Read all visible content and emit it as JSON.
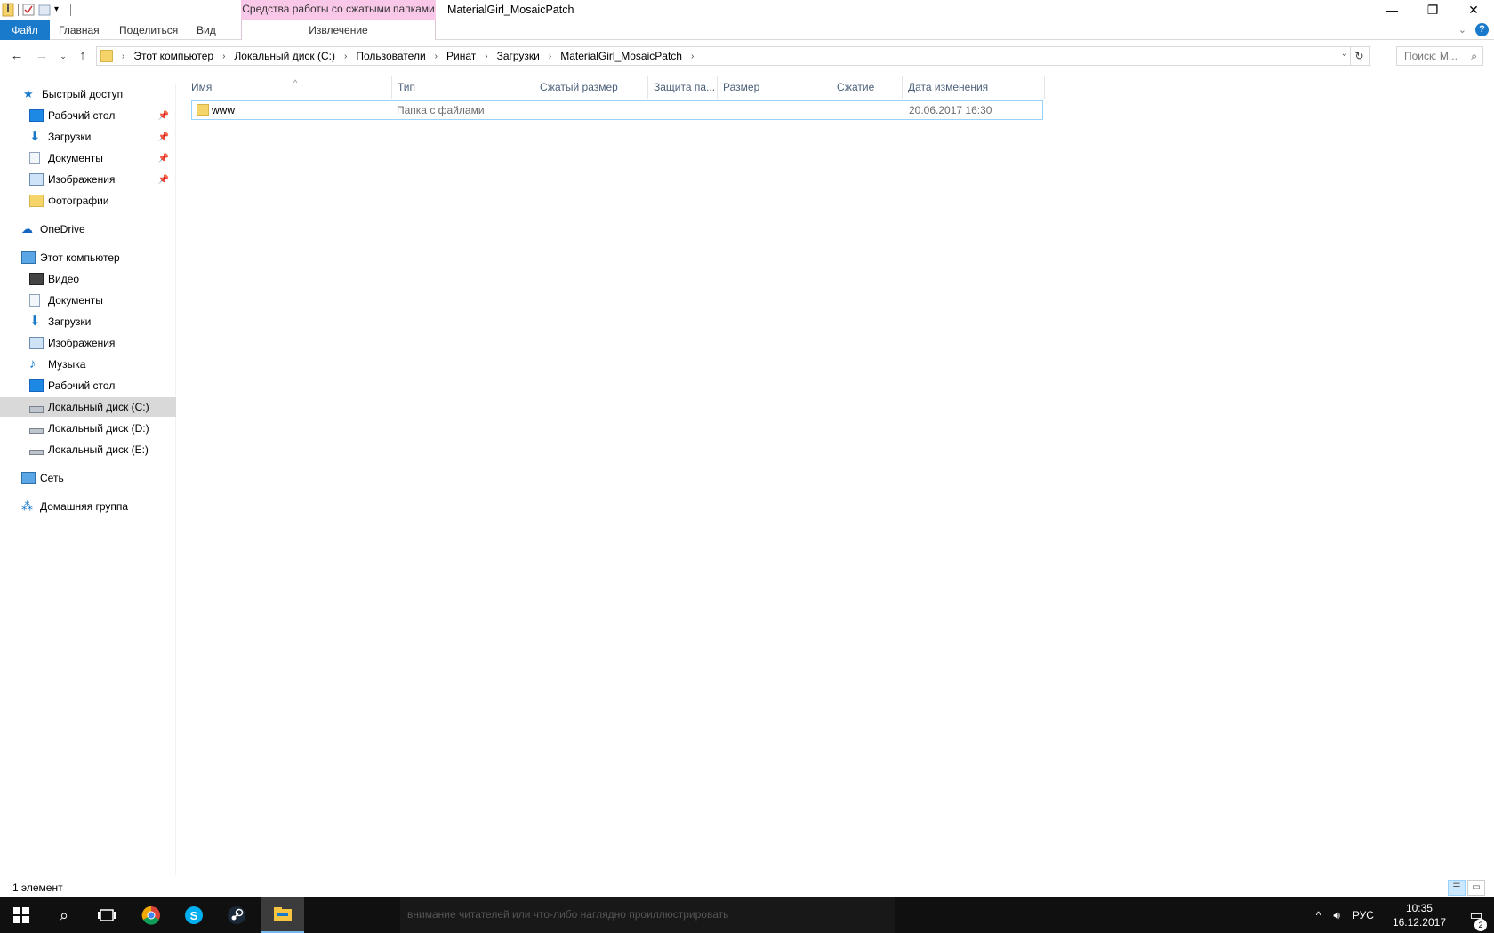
{
  "window": {
    "title": "MaterialGirl_MosaicPatch",
    "context_tab_header": "Средства работы со сжатыми папками",
    "minimize_icon": "minimize-icon",
    "restore_icon": "restore-icon",
    "close_icon": "close-icon"
  },
  "ribbon": {
    "tabs": [
      "Файл",
      "Главная",
      "Поделиться",
      "Вид"
    ],
    "context_tab": "Извлечение",
    "accent": "#1979ca"
  },
  "address": {
    "crumbs": [
      "Этот компьютер",
      "Локальный диск (C:)",
      "Пользователи",
      "Ринат",
      "Загрузки",
      "MaterialGirl_MosaicPatch"
    ],
    "search_placeholder": "Поиск: M..."
  },
  "nav": {
    "quick_access": "Быстрый доступ",
    "quick_items": [
      "Рабочий стол",
      "Загрузки",
      "Документы",
      "Изображения",
      "Фотографии"
    ],
    "onedrive": "OneDrive",
    "this_pc": "Этот компьютер",
    "pc_items": [
      "Видео",
      "Документы",
      "Загрузки",
      "Изображения",
      "Музыка",
      "Рабочий стол",
      "Локальный диск (C:)",
      "Локальный диск (D:)",
      "Локальный диск (E:)"
    ],
    "network": "Сеть",
    "homegroup": "Домашняя группа",
    "selected": "Локальный диск (C:)"
  },
  "columns": [
    "Имя",
    "Тип",
    "Сжатый размер",
    "Защита па...",
    "Размер",
    "Сжатие",
    "Дата изменения"
  ],
  "files": [
    {
      "name": "www",
      "type": "Папка с файлами",
      "compressed": "",
      "protected": "",
      "size": "",
      "ratio": "",
      "modified": "20.06.2017 16:30"
    }
  ],
  "status": {
    "count": "1 элемент"
  },
  "taskbar": {
    "ghost_text": "внимание читателей или что-либо наглядно проиллюстрировать",
    "lang": "РУС",
    "time": "10:35",
    "date": "16.12.2017",
    "notifications": "2"
  }
}
